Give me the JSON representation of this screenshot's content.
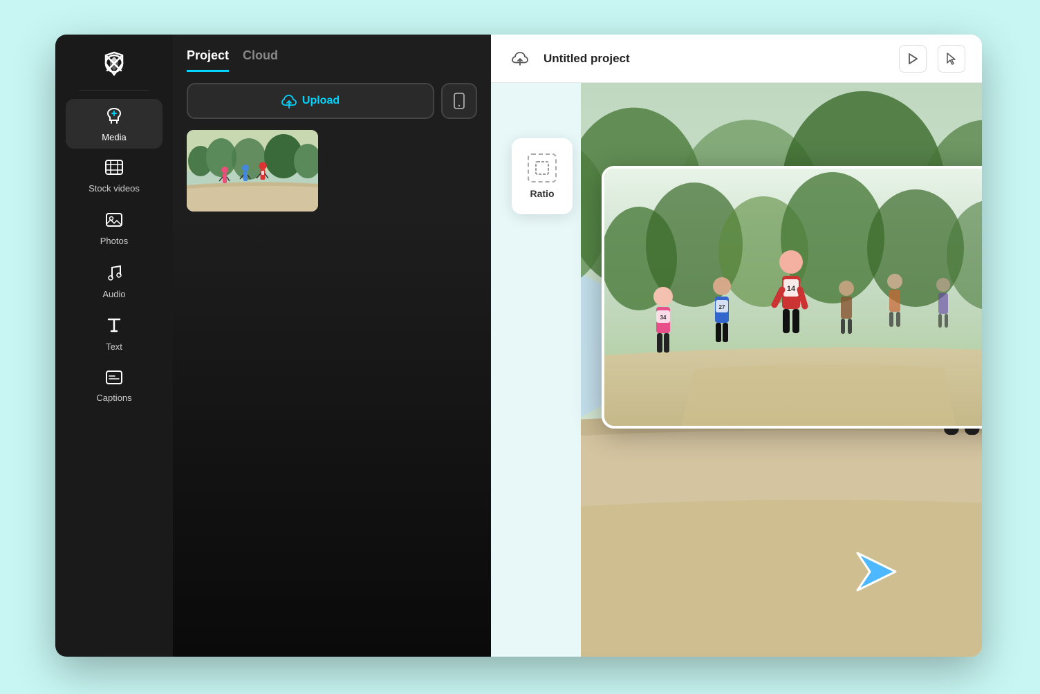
{
  "app": {
    "logo_alt": "CapCut logo",
    "background_color": "#c8f7f3"
  },
  "sidebar": {
    "items": [
      {
        "id": "media",
        "label": "Media",
        "icon": "upload-cloud",
        "active": true
      },
      {
        "id": "stock-videos",
        "label": "Stock\nvideos",
        "icon": "film-grid",
        "active": false
      },
      {
        "id": "photos",
        "label": "Photos",
        "icon": "photo",
        "active": false
      },
      {
        "id": "audio",
        "label": "Audio",
        "icon": "music-note",
        "active": false
      },
      {
        "id": "text",
        "label": "Text",
        "icon": "text-t",
        "active": false
      },
      {
        "id": "captions",
        "label": "Captions",
        "icon": "captions",
        "active": false
      }
    ]
  },
  "media_panel": {
    "tabs": [
      {
        "id": "project",
        "label": "Project",
        "active": true
      },
      {
        "id": "cloud",
        "label": "Cloud",
        "active": false
      }
    ],
    "upload_button_label": "Upload",
    "mobile_icon": "smartphone"
  },
  "preview": {
    "project_title": "Untitled project",
    "ratio_label": "Ratio",
    "play_icon": "play",
    "cursor_icon": "cursor"
  }
}
